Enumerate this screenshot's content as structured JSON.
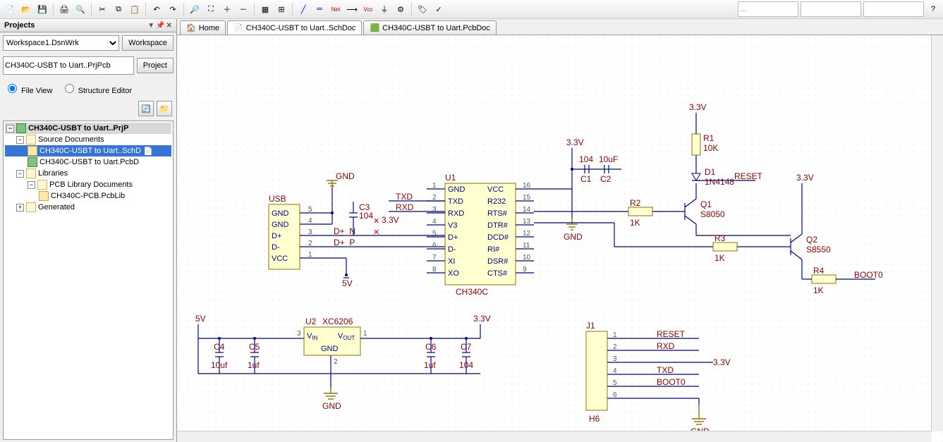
{
  "toolbar": {
    "right_partial_text": "..."
  },
  "projects": {
    "title": "Projects",
    "workspace_sel": "Workspace1.DsnWrk",
    "workspace_btn": "Workspace",
    "project_name": "CH340C-USBT to Uart..PrjPcb",
    "project_btn": "Project",
    "view_file": "File View",
    "view_struct": "Structure Editor",
    "tree": {
      "root": "CH340C-USBT to Uart..PrjP",
      "src": "Source Documents",
      "sch": "CH340C-USBT to Uart..SchD",
      "pcb": "CH340C-USBT to Uart.PcbD",
      "libs": "Libraries",
      "pcblib_folder": "PCB Library Documents",
      "pcblib": "CH340C-PCB.PcbLib",
      "gen": "Generated"
    }
  },
  "tabs": {
    "home": "Home",
    "sch": "CH340C-USBT to Uart..SchDoc",
    "pcb": "CH340C-USBT to Uart.PcbDoc"
  },
  "sch": {
    "USB": {
      "des": "USB",
      "pins": [
        "GND",
        "GND",
        "D+",
        "D-",
        "VCC"
      ],
      "nums": [
        "5",
        "4",
        "3",
        "2",
        "1"
      ]
    },
    "C3": {
      "des": "C3",
      "val": "104"
    },
    "D_plus_N": "D+_N",
    "D_plus_P": "D+_P",
    "net_5v": "5V",
    "net_gnd": "GND",
    "net_33": "3.3V",
    "net_txd": "TXD",
    "net_rxd": "RXD",
    "U1": {
      "des": "U1",
      "val": "CH340C",
      "left_pins": [
        [
          "1",
          "GND"
        ],
        [
          "2",
          "TXD"
        ],
        [
          "3",
          "RXD"
        ],
        [
          "4",
          "V3"
        ],
        [
          "5",
          "D+"
        ],
        [
          "6",
          "D-"
        ],
        [
          "7",
          "XI"
        ],
        [
          "8",
          "XO"
        ]
      ],
      "right_pins": [
        [
          "16",
          "VCC"
        ],
        [
          "15",
          "R232"
        ],
        [
          "14",
          "RTS#"
        ],
        [
          "13",
          "DTR#"
        ],
        [
          "12",
          "DCD#"
        ],
        [
          "11",
          "RI#"
        ],
        [
          "10",
          "DSR#"
        ],
        [
          "9",
          "CTS#"
        ]
      ]
    },
    "C1": {
      "des": "C1",
      "val": "104"
    },
    "C2": {
      "des": "C2",
      "val": "10uF"
    },
    "R1": {
      "des": "R1",
      "val": "10K"
    },
    "D1": {
      "des": "D1",
      "val": "1N4148"
    },
    "Q1": {
      "des": "Q1",
      "val": "S8050"
    },
    "Q2": {
      "des": "Q2",
      "val": "S8550"
    },
    "R2": {
      "des": "R2",
      "val": "1K"
    },
    "R3": {
      "des": "R3",
      "val": "1K"
    },
    "R4": {
      "des": "R4",
      "val": "1K"
    },
    "net_reset": "RESET",
    "net_boot0": "BOOT0",
    "U2": {
      "des": "U2",
      "val": "XC6206",
      "pins": [
        "VIN",
        "VOUT",
        "GND"
      ],
      "nums": [
        "3",
        "1",
        "2"
      ]
    },
    "C4": {
      "des": "C4",
      "val": "10uf"
    },
    "C5": {
      "des": "C5",
      "val": "1uf"
    },
    "C6": {
      "des": "C6",
      "val": "1uf"
    },
    "C7": {
      "des": "C7",
      "val": "104"
    },
    "J1": {
      "des": "J1",
      "val": "H6",
      "pins": [
        "1",
        "2",
        "3",
        "4",
        "5",
        "6"
      ],
      "nets": [
        "RESET",
        "RXD",
        "",
        "TXD",
        "BOOT0",
        ""
      ]
    }
  }
}
